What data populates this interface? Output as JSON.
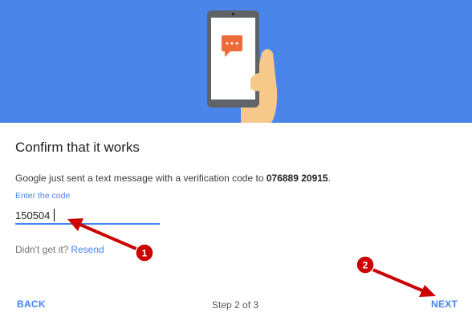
{
  "header": {
    "colors": {
      "background": "#4a85ea",
      "phone_frame": "#5f6368",
      "phone_screen": "#ffffff",
      "chat_bubble": "#ef6c3a",
      "hand": "#f6c98a"
    },
    "illustration_icons": [
      "phone-icon",
      "chat-bubble-icon",
      "hand-icon"
    ]
  },
  "content": {
    "title": "Confirm that it works",
    "message_prefix": "Google just sent a text message with a verification code to ",
    "phone_number": "076889 20915",
    "message_suffix": ".",
    "code_label": "Enter the code",
    "code_value": "150504",
    "didnt_get": "Didn't get it?",
    "resend_label": "Resend"
  },
  "footer": {
    "back_label": "BACK",
    "step_text": "Step 2 of 3",
    "next_label": "NEXT"
  },
  "annotations": {
    "badge_1": "1",
    "badge_2": "2",
    "color": "#cc0000"
  }
}
